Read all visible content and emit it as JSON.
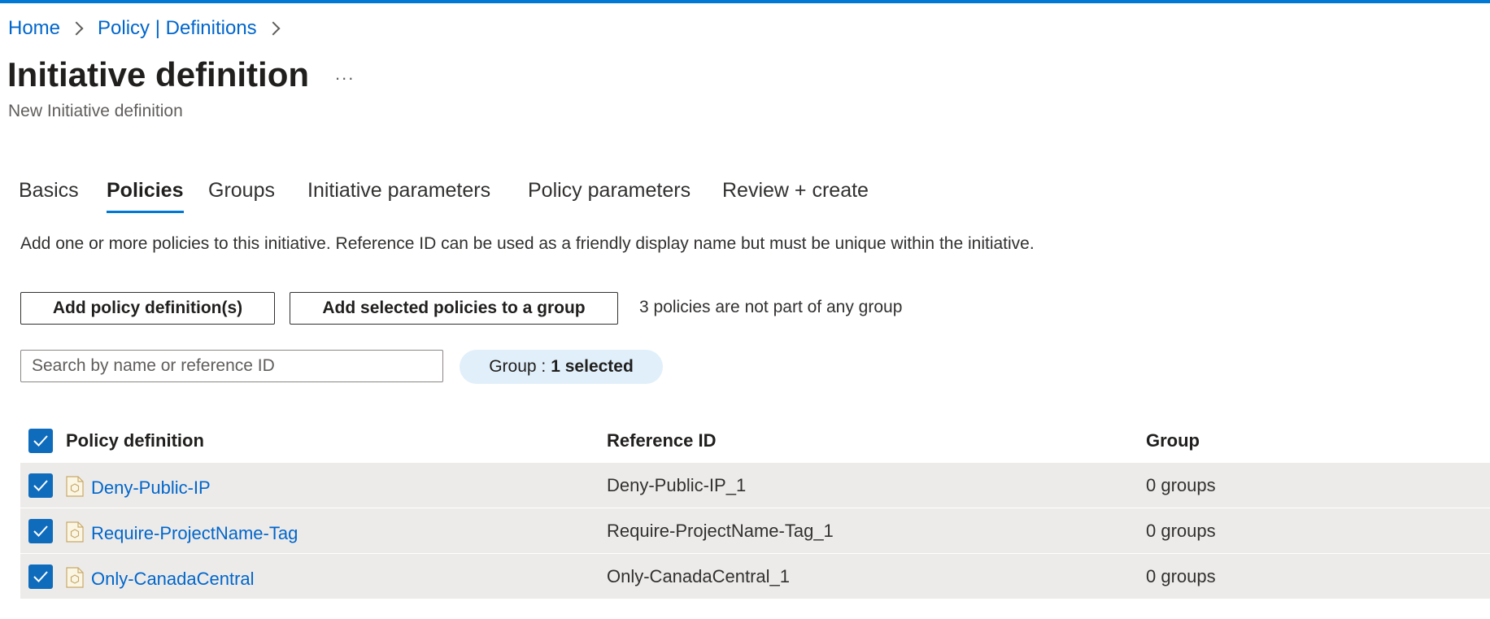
{
  "breadcrumb": {
    "items": [
      "Home",
      "Policy | Definitions"
    ]
  },
  "header": {
    "title": "Initiative definition",
    "more": "...",
    "subtitle": "New Initiative definition"
  },
  "tabs": [
    {
      "label": "Basics",
      "active": false
    },
    {
      "label": "Policies",
      "active": true
    },
    {
      "label": "Groups",
      "active": false
    },
    {
      "label": "Initiative parameters",
      "active": false
    },
    {
      "label": "Policy parameters",
      "active": false
    },
    {
      "label": "Review + create",
      "active": false
    }
  ],
  "description": "Add one or more policies to this initiative. Reference ID can be used as a friendly display name but must be unique within the initiative.",
  "toolbar": {
    "add_policy_label": "Add policy definition(s)",
    "add_to_group_label": "Add selected policies to a group",
    "group_note": "3 policies are not part of any group"
  },
  "filters": {
    "search_placeholder": "Search by name or reference ID",
    "search_value": "",
    "group_label": "Group :",
    "group_value": "1 selected"
  },
  "table": {
    "columns": [
      "Policy definition",
      "Reference ID",
      "Group"
    ],
    "rows": [
      {
        "policy": "Deny-Public-IP",
        "reference_id": "Deny-Public-IP_1",
        "group": "0 groups",
        "checked": true
      },
      {
        "policy": "Require-ProjectName-Tag",
        "reference_id": "Require-ProjectName-Tag_1",
        "group": "0 groups",
        "checked": true
      },
      {
        "policy": "Only-CanadaCentral",
        "reference_id": "Only-CanadaCentral_1",
        "group": "0 groups",
        "checked": true
      }
    ]
  },
  "colors": {
    "accent": "#0078d4",
    "link": "#0066cc",
    "checkbox": "#0f6cbd",
    "row_bg": "#edebe9",
    "pill_bg": "#e1effa"
  }
}
